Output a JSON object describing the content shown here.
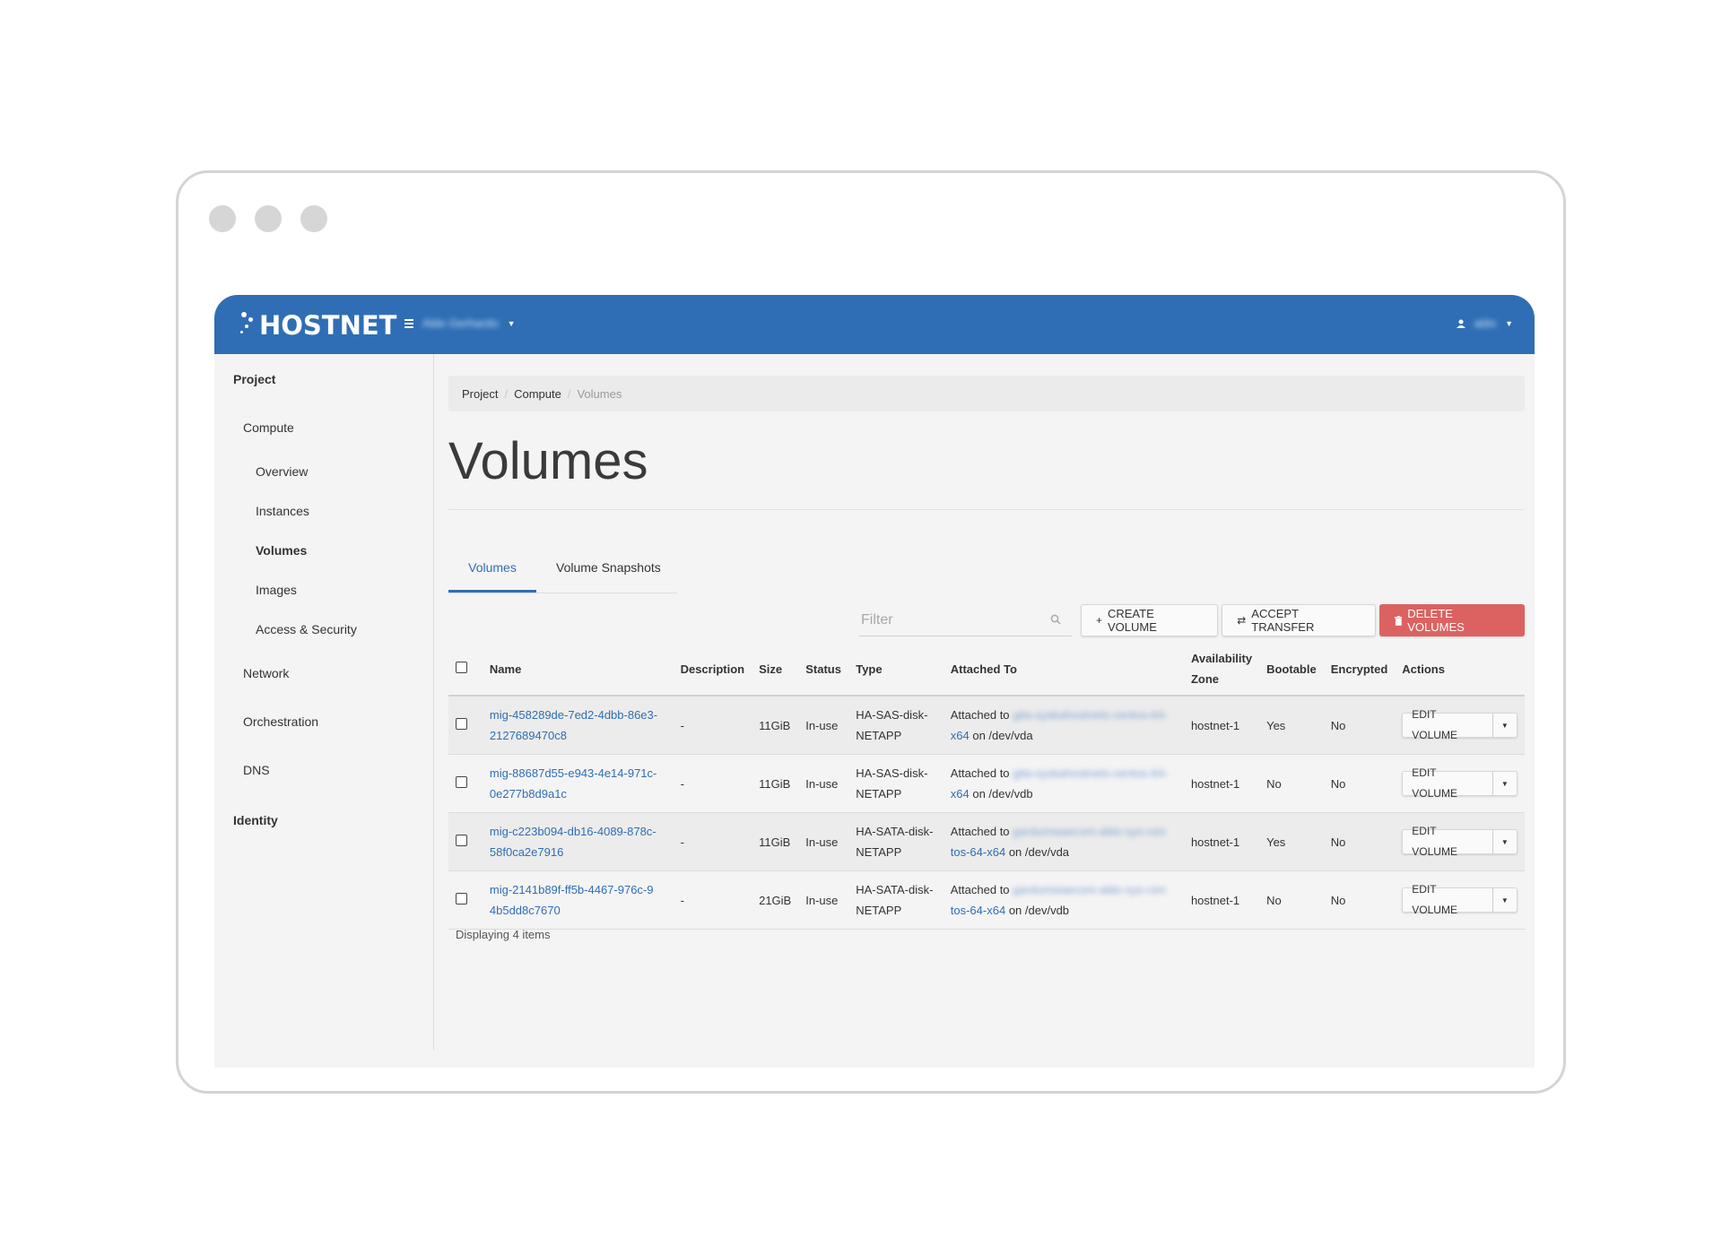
{
  "topbar": {
    "brand": "HOSTNET",
    "project_selector": "Aldo Gerhardo",
    "user_name": "aldo"
  },
  "sidebar": {
    "sections": [
      {
        "label": "Project"
      },
      {
        "label": "Compute"
      },
      {
        "label": "Overview"
      },
      {
        "label": "Instances"
      },
      {
        "label": "Volumes"
      },
      {
        "label": "Images"
      },
      {
        "label": "Access & Security"
      },
      {
        "label": "Network"
      },
      {
        "label": "Orchestration"
      },
      {
        "label": "DNS"
      },
      {
        "label": "Identity"
      }
    ]
  },
  "breadcrumb": [
    "Project",
    "Compute",
    "Volumes"
  ],
  "page_title": "Volumes",
  "tabs": [
    "Volumes",
    "Volume Snapshots"
  ],
  "toolbar": {
    "filter_placeholder": "Filter",
    "create_label": "Create Volume",
    "accept_label": "Accept Transfer",
    "delete_label": "Delete Volumes"
  },
  "table": {
    "headers": {
      "name": "Name",
      "description": "Description",
      "size": "Size",
      "status": "Status",
      "type": "Type",
      "attached": "Attached To",
      "zone_line1": "Availability",
      "zone_line2": "Zone",
      "bootable": "Bootable",
      "encrypted": "Encrypted",
      "actions": "Actions"
    },
    "rows": [
      {
        "name_1": "mig-458289de-7ed2-4dbb-86e3-",
        "name_2": "2127689470c8",
        "description": "-",
        "size": "11GiB",
        "status": "In-use",
        "type_1": "HA-SAS-disk-",
        "type_2": "NETAPP",
        "attached_prefix": "Attached to",
        "attached_host_1": "gita-syskahostnets-centos-64-",
        "attached_host_2": "x64",
        "attached_device": "on /dev/vda",
        "zone": "hostnet-1",
        "bootable": "Yes",
        "encrypted": "No",
        "action": "Edit Volume"
      },
      {
        "name_1": "mig-88687d55-e943-4e14-971c-",
        "name_2": "0e277b8d9a1c",
        "description": "-",
        "size": "11GiB",
        "status": "In-use",
        "type_1": "HA-SAS-disk-",
        "type_2": "NETAPP",
        "attached_prefix": "Attached to",
        "attached_host_1": "gita-syskahostnets-centos-64-",
        "attached_host_2": "x64",
        "attached_device": "on /dev/vdb",
        "zone": "hostnet-1",
        "bootable": "No",
        "encrypted": "No",
        "action": "Edit Volume"
      },
      {
        "name_1": "mig-c223b094-db16-4089-878c-",
        "name_2": "58f0ca2e7916",
        "description": "-",
        "size": "11GiB",
        "status": "In-use",
        "type_1": "HA-SATA-disk-",
        "type_2": "NETAPP",
        "attached_prefix": "Attached to",
        "attached_host_1": "gardumwaecom-aldo-sys-cen",
        "attached_host_2": "tos-64-x64",
        "attached_device": "on /dev/vda",
        "zone": "hostnet-1",
        "bootable": "Yes",
        "encrypted": "No",
        "action": "Edit Volume"
      },
      {
        "name_1": "mig-2141b89f-ff5b-4467-976c-9",
        "name_2": "4b5dd8c7670",
        "description": "-",
        "size": "21GiB",
        "status": "In-use",
        "type_1": "HA-SATA-disk-",
        "type_2": "NETAPP",
        "attached_prefix": "Attached to",
        "attached_host_1": "gardumwaecom-aldo-sys-cen",
        "attached_host_2": "tos-64-x64",
        "attached_device": "on /dev/vdb",
        "zone": "hostnet-1",
        "bootable": "No",
        "encrypted": "No",
        "action": "Edit Volume"
      }
    ]
  },
  "footer": "Displaying 4 items",
  "colors": {
    "brand_blue": "#2f6eb5",
    "danger_red": "#dc6262",
    "background": "#f4f4f4"
  }
}
